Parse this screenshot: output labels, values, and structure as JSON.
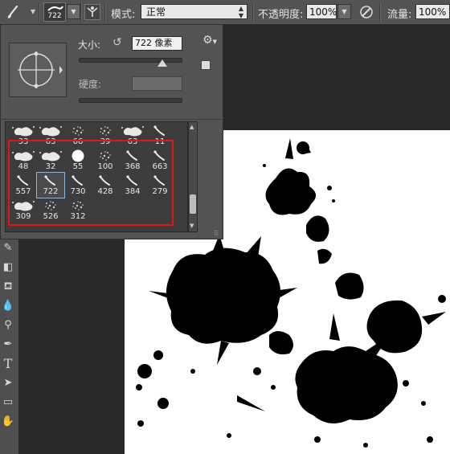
{
  "options_bar": {
    "brush_size_label": "722",
    "mode_label": "模式:",
    "mode_value": "正常",
    "opacity_label": "不透明度:",
    "opacity_value": "100%",
    "flow_label": "流量:",
    "flow_value": "100%"
  },
  "brush_panel": {
    "size_label": "大小:",
    "size_value": "722 像素",
    "hardness_label": "硬度:",
    "size_slider_fraction": 0.82,
    "brushes": [
      {
        "num": "33",
        "thumb": "splatter"
      },
      {
        "num": "63",
        "thumb": "splatter"
      },
      {
        "num": "66",
        "thumb": "speckle"
      },
      {
        "num": "39",
        "thumb": "speckle"
      },
      {
        "num": "63",
        "thumb": "splatter"
      },
      {
        "num": "11",
        "thumb": "stroke"
      },
      {
        "num": "48",
        "thumb": "splatter"
      },
      {
        "num": "32",
        "thumb": "splatter"
      },
      {
        "num": "55",
        "thumb": "round"
      },
      {
        "num": "100",
        "thumb": "speckle"
      },
      {
        "num": "368",
        "thumb": "stroke"
      },
      {
        "num": "663",
        "thumb": "stroke"
      },
      {
        "num": "557",
        "thumb": "stroke"
      },
      {
        "num": "722",
        "thumb": "stroke"
      },
      {
        "num": "730",
        "thumb": "stroke"
      },
      {
        "num": "428",
        "thumb": "stroke"
      },
      {
        "num": "384",
        "thumb": "stroke"
      },
      {
        "num": "279",
        "thumb": "stroke"
      },
      {
        "num": "309",
        "thumb": "splatter"
      },
      {
        "num": "526",
        "thumb": "speckle"
      },
      {
        "num": "312",
        "thumb": "speckle"
      }
    ],
    "selected_brush": "722"
  },
  "colors": {
    "panel_bg": "#535353",
    "highlight": "#e0141b",
    "canvas": "#ffffff",
    "ink": "#000000"
  }
}
